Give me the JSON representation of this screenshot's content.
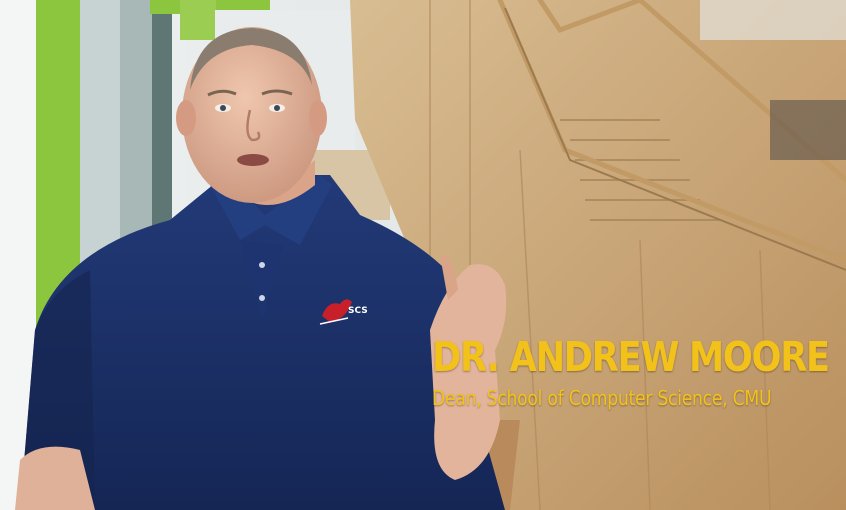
{
  "lower_third": {
    "name": "DR. ANDREW MOORE",
    "title": "Dean, School of Computer Science, CMU"
  },
  "shirt_logo": {
    "text": "SCS"
  },
  "colors": {
    "caption_yellow": "#f2c21b",
    "shirt_navy": "#1b2d63",
    "wall_green": "#8cc63f",
    "wood": "#c8a77a"
  }
}
